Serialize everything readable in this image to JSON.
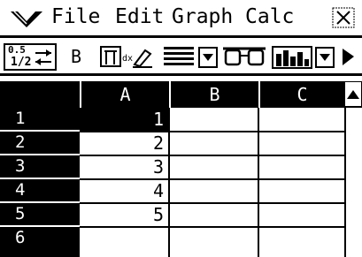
{
  "menubar": {
    "items": [
      "File",
      "Edit",
      "Graph",
      "Calc"
    ]
  },
  "toolbar": {
    "fraction_button": {
      "top": "0.5",
      "bottom": "1/2"
    },
    "bold_button_label": "B"
  },
  "grid": {
    "columns": [
      "A",
      "B",
      "C"
    ],
    "rows": [
      {
        "label": "1",
        "A": "1",
        "B": "",
        "C": ""
      },
      {
        "label": "2",
        "A": "2",
        "B": "",
        "C": ""
      },
      {
        "label": "3",
        "A": "3",
        "B": "",
        "C": ""
      },
      {
        "label": "4",
        "A": "4",
        "B": "",
        "C": ""
      },
      {
        "label": "5",
        "A": "5",
        "B": "",
        "C": ""
      },
      {
        "label": "6",
        "A": "",
        "B": "",
        "C": ""
      }
    ],
    "selected_cell": "A1"
  }
}
